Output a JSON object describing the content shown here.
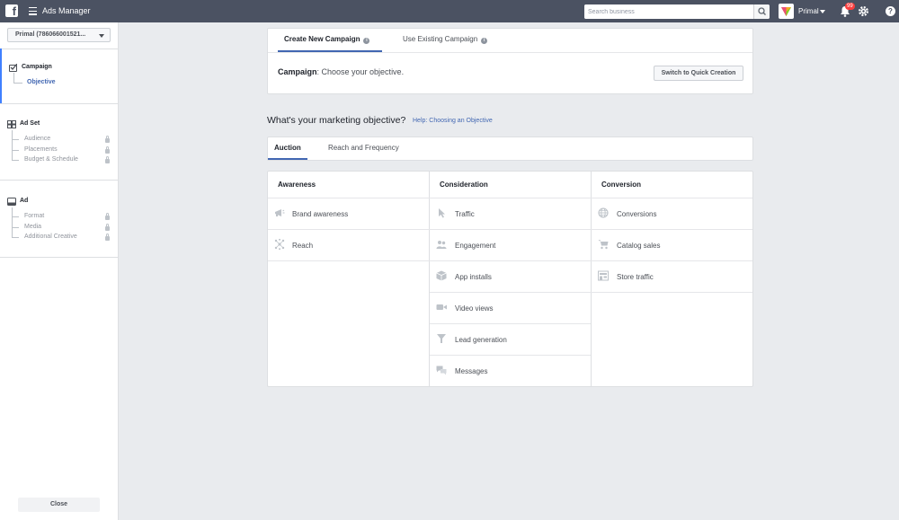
{
  "topbar": {
    "logo": "f",
    "app_title": "Ads Manager",
    "search_placeholder": "Search business",
    "account_name": "Primal",
    "notification_count": "99",
    "help": "?"
  },
  "sidebar": {
    "account_selector": "Primal (786066001521...",
    "sections": [
      {
        "title": "Campaign",
        "items": [
          {
            "label": "Objective",
            "active": true
          }
        ]
      },
      {
        "title": "Ad Set",
        "items": [
          {
            "label": "Audience"
          },
          {
            "label": "Placements"
          },
          {
            "label": "Budget & Schedule"
          }
        ]
      },
      {
        "title": "Ad",
        "items": [
          {
            "label": "Format"
          },
          {
            "label": "Media"
          },
          {
            "label": "Additional Creative"
          }
        ]
      }
    ],
    "close_label": "Close"
  },
  "campaign_card": {
    "tabs": [
      "Create New Campaign",
      "Use Existing Campaign"
    ],
    "campaign_bold": "Campaign",
    "campaign_text": ": Choose your objective.",
    "quick_button": "Switch to Quick Creation"
  },
  "objective": {
    "question": "What's your marketing objective?",
    "help_link": "Help: Choosing an Objective",
    "buying_tabs": [
      "Auction",
      "Reach and Frequency"
    ],
    "columns": [
      {
        "title": "Awareness",
        "items": [
          {
            "label": "Brand awareness",
            "icon": "megaphone-icon"
          },
          {
            "label": "Reach",
            "icon": "reach-icon"
          }
        ]
      },
      {
        "title": "Consideration",
        "items": [
          {
            "label": "Traffic",
            "icon": "cursor-icon"
          },
          {
            "label": "Engagement",
            "icon": "people-icon"
          },
          {
            "label": "App installs",
            "icon": "box-icon"
          },
          {
            "label": "Video views",
            "icon": "video-camera-icon"
          },
          {
            "label": "Lead generation",
            "icon": "funnel-icon"
          },
          {
            "label": "Messages",
            "icon": "chat-bubbles-icon"
          }
        ]
      },
      {
        "title": "Conversion",
        "items": [
          {
            "label": "Conversions",
            "icon": "globe-icon"
          },
          {
            "label": "Catalog sales",
            "icon": "cart-icon"
          },
          {
            "label": "Store traffic",
            "icon": "store-icon"
          }
        ]
      }
    ]
  },
  "colors": {
    "topbar": "#4b5262",
    "accent": "#4267b2",
    "background": "#e9ebee"
  }
}
